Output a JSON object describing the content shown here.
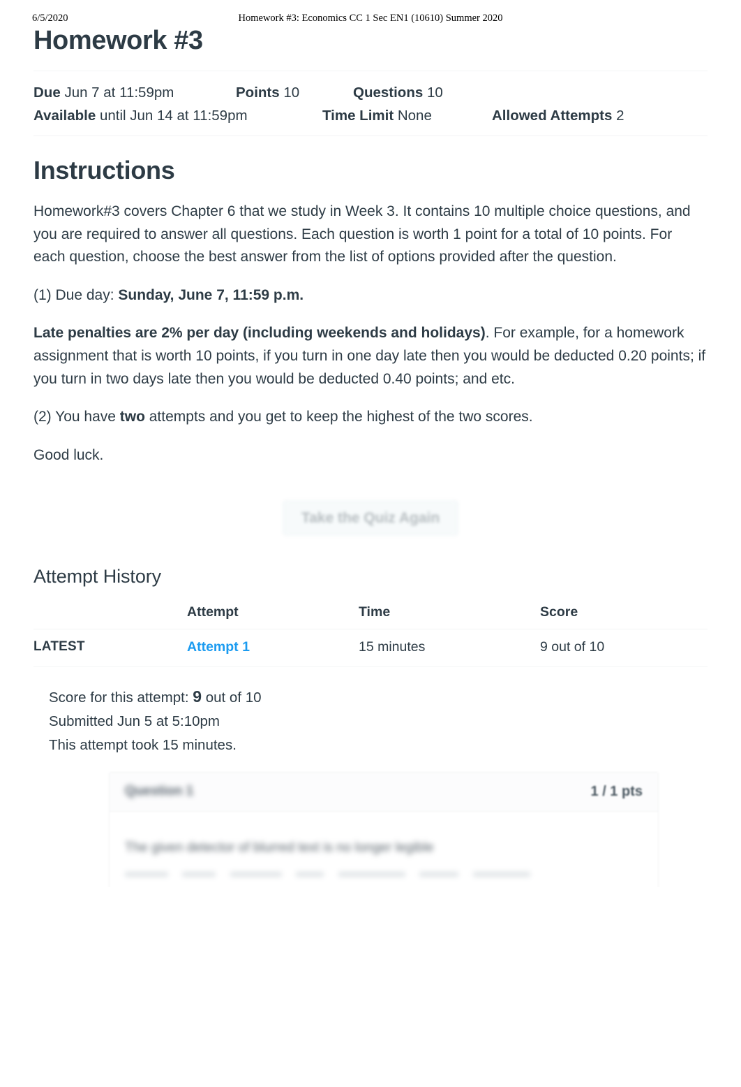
{
  "print_header": {
    "date": "6/5/2020",
    "title": "Homework #3: Economics CC 1 Sec EN1 (10610) Summer 2020"
  },
  "quiz": {
    "title": "Homework #3",
    "details": {
      "due_label": "Due",
      "due_value": "Jun 7 at 11:59pm",
      "points_label": "Points",
      "points_value": "10",
      "questions_label": "Questions",
      "questions_value": "10",
      "available_label": "Available",
      "available_value": "until Jun 14 at 11:59pm",
      "time_limit_label": "Time Limit",
      "time_limit_value": "None",
      "allowed_attempts_label": "Allowed Attempts",
      "allowed_attempts_value": "2"
    }
  },
  "instructions": {
    "heading": "Instructions",
    "p1": "Homework#3 covers Chapter 6 that we study in Week 3. It contains 10 multiple choice questions, and you are required to answer all questions. Each question is worth 1 point for a total of 10 points. For each question, choose the best answer from the list of options provided after the question.",
    "p2_prefix": "(1) Due day: ",
    "p2_bold": "Sunday, June 7, 11:59 p.m.",
    "p3_bold": "Late penalties are 2% per day (including weekends and holidays)",
    "p3_rest": ". For example, for a homework assignment that is worth 10 points, if you turn in one day late then you would be deducted 0.20 points; if you turn in two days late then you would be deducted 0.40 points; and etc.",
    "p4_prefix": "(2) You have ",
    "p4_bold": "two",
    "p4_suffix": " attempts and you get to keep the highest of the two scores.",
    "p5": "Good luck."
  },
  "actions": {
    "take_quiz_again": "Take the Quiz Again"
  },
  "attempt_history": {
    "heading": "Attempt History",
    "columns": {
      "latest": "",
      "attempt": "Attempt",
      "time": "Time",
      "score": "Score"
    },
    "rows": [
      {
        "latest": "LATEST",
        "attempt": "Attempt 1",
        "time": "15 minutes",
        "score": "9 out of 10"
      }
    ]
  },
  "attempt_summary": {
    "score_prefix": "Score for this attempt: ",
    "score_value": "9",
    "score_suffix": " out of 10",
    "submitted": "Submitted Jun 5 at 5:10pm",
    "duration": "This attempt took 15 minutes."
  },
  "question_card": {
    "name": "Question 1",
    "points": "1 / 1 pts",
    "text": "The given detector of blurred text is no longer legible"
  },
  "colors": {
    "link_blue": "#1b9bf0",
    "text": "#2d3b45",
    "muted": "#9aa3a8",
    "rule": "#f2f3f4"
  }
}
